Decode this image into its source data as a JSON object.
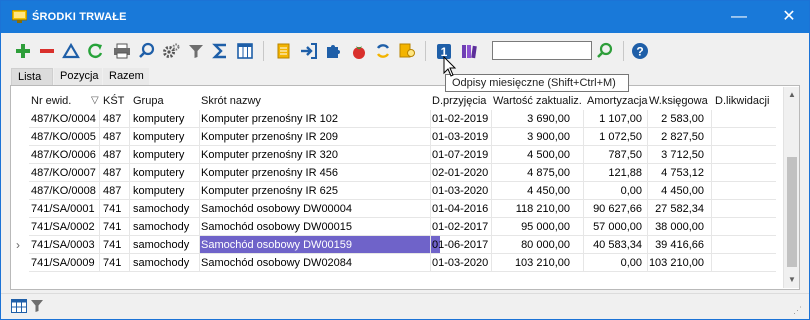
{
  "window": {
    "title": "ŚRODKI TRWAŁE",
    "minimize_glyph": "—",
    "close_glyph": "✕"
  },
  "toolbar": {
    "icons": [
      "add-icon",
      "delete-icon",
      "up-icon",
      "refresh-icon",
      "print-icon",
      "search-icon",
      "settings-icon",
      "filter-icon",
      "sum-icon",
      "columns-icon",
      "document-icon",
      "import-icon",
      "puzzle-icon",
      "tomato-icon",
      "cycle-icon",
      "idea-icon",
      "monthly-depreciation-icon",
      "books-icon",
      "search-go-icon",
      "help-icon"
    ],
    "search_value": ""
  },
  "tooltip": "Odpisy miesięczne (Shift+Ctrl+M)",
  "tabs": [
    {
      "label": "Lista",
      "active": true
    },
    {
      "label": "Pozycja",
      "active": false
    },
    {
      "label": "Razem",
      "active": false
    }
  ],
  "table": {
    "columns": [
      "Nr ewid.",
      "KŚT",
      "Grupa",
      "Skrót nazwy",
      "D.przyjęcia",
      "Wartość zaktualiz.",
      "Amortyzacja",
      "W.księgowa",
      "D.likwidacji"
    ],
    "sort_glyph": "▽",
    "rows": [
      [
        "487/KO/0004",
        "487",
        "komputery",
        "Komputer przenośny IR 102",
        "01-02-2019",
        "3 690,00",
        "1 107,00",
        "2 583,00",
        ""
      ],
      [
        "487/KO/0005",
        "487",
        "komputery",
        "Komputer przenośny IR 209",
        "01-03-2019",
        "3 900,00",
        "1 072,50",
        "2 827,50",
        ""
      ],
      [
        "487/KO/0006",
        "487",
        "komputery",
        "Komputer przenośny IR 320",
        "01-07-2019",
        "4 500,00",
        "787,50",
        "3 712,50",
        ""
      ],
      [
        "487/KO/0007",
        "487",
        "komputery",
        "Komputer przenośny IR 456",
        "02-01-2020",
        "4 875,00",
        "121,88",
        "4 753,12",
        ""
      ],
      [
        "487/KO/0008",
        "487",
        "komputery",
        "Komputer przenośny IR 625",
        "01-03-2020",
        "4 450,00",
        "0,00",
        "4 450,00",
        ""
      ],
      [
        "741/SA/0001",
        "741",
        "samochody",
        "Samochód osobowy DW00004",
        "01-04-2016",
        "118 210,00",
        "90 627,66",
        "27 582,34",
        ""
      ],
      [
        "741/SA/0002",
        "741",
        "samochody",
        "Samochód osobowy DW00015",
        "01-02-2017",
        "95 000,00",
        "57 000,00",
        "38 000,00",
        ""
      ],
      [
        "741/SA/0003",
        "741",
        "samochody",
        "Samochód osobowy DW00159",
        "01-06-2017",
        "80 000,00",
        "40 583,34",
        "39 416,66",
        ""
      ],
      [
        "741/SA/0009",
        "741",
        "samochody",
        "Samochód osobowy DW02084",
        "01-03-2020",
        "103 210,00",
        "0,00",
        "103 210,00",
        ""
      ]
    ],
    "current_row": 7,
    "selected_cell_column": 3,
    "current_row_glyph": "›"
  },
  "statusbar": {
    "icons": [
      "grid-view-icon",
      "filter-icon"
    ],
    "grip_glyph": "⋰"
  }
}
